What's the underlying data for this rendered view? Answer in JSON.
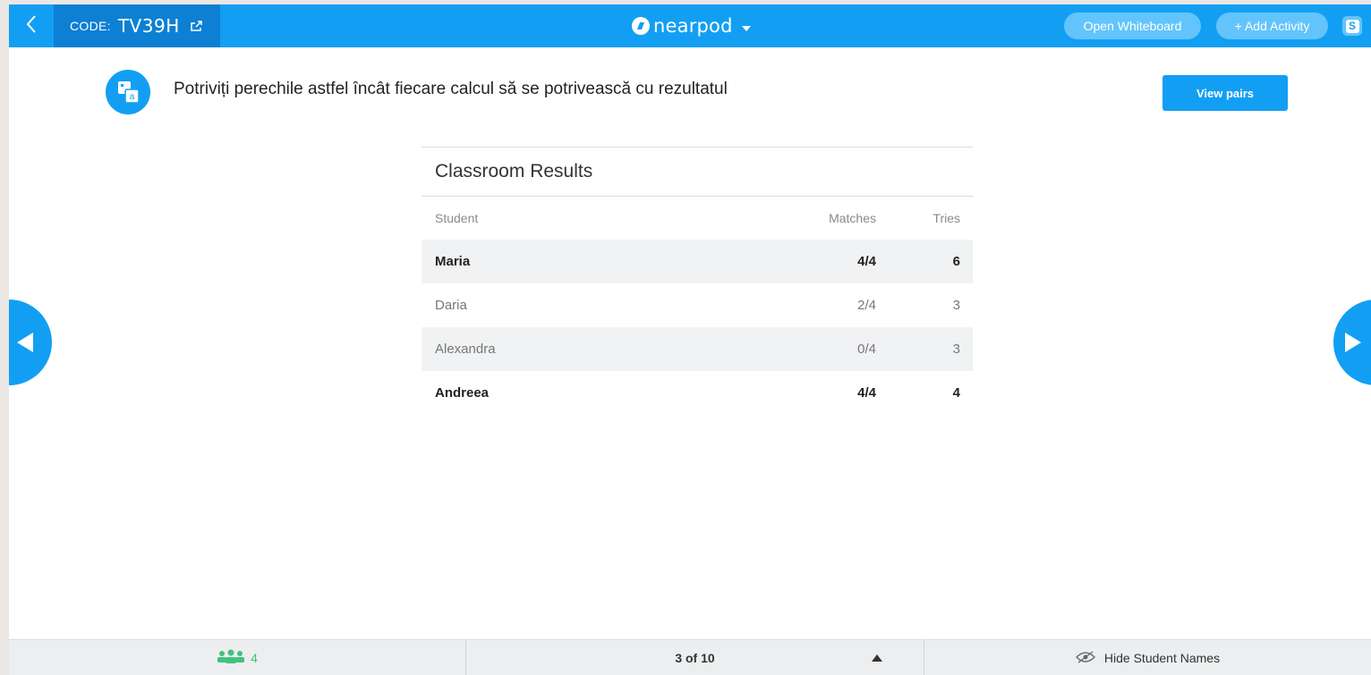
{
  "topbar": {
    "code_label": "CODE:",
    "code_value": "TV39H",
    "brand": "nearpod",
    "open_whiteboard": "Open Whiteboard",
    "add_activity": "+ Add Activity",
    "profile_letter": "S"
  },
  "activity": {
    "title": "Potriviți perechile astfel încât fiecare calcul să se potrivească cu rezultatul",
    "view_pairs": "View pairs",
    "icon_letter": "a"
  },
  "results": {
    "title": "Classroom Results",
    "columns": {
      "student": "Student",
      "matches": "Matches",
      "tries": "Tries"
    },
    "rows": [
      {
        "student": "Maria",
        "matches": "4/4",
        "tries": "6"
      },
      {
        "student": "Daria",
        "matches": "2/4",
        "tries": "3"
      },
      {
        "student": "Alexandra",
        "matches": "0/4",
        "tries": "3"
      },
      {
        "student": "Andreea",
        "matches": "4/4",
        "tries": "4"
      }
    ]
  },
  "bottombar": {
    "student_count": "4",
    "page": "3 of 10",
    "hide_names": "Hide Student Names"
  },
  "colors": {
    "primary": "#129ff3",
    "code_bg": "#0d80d3",
    "pill": "#63c4fb",
    "students_green": "#3fc37c"
  }
}
